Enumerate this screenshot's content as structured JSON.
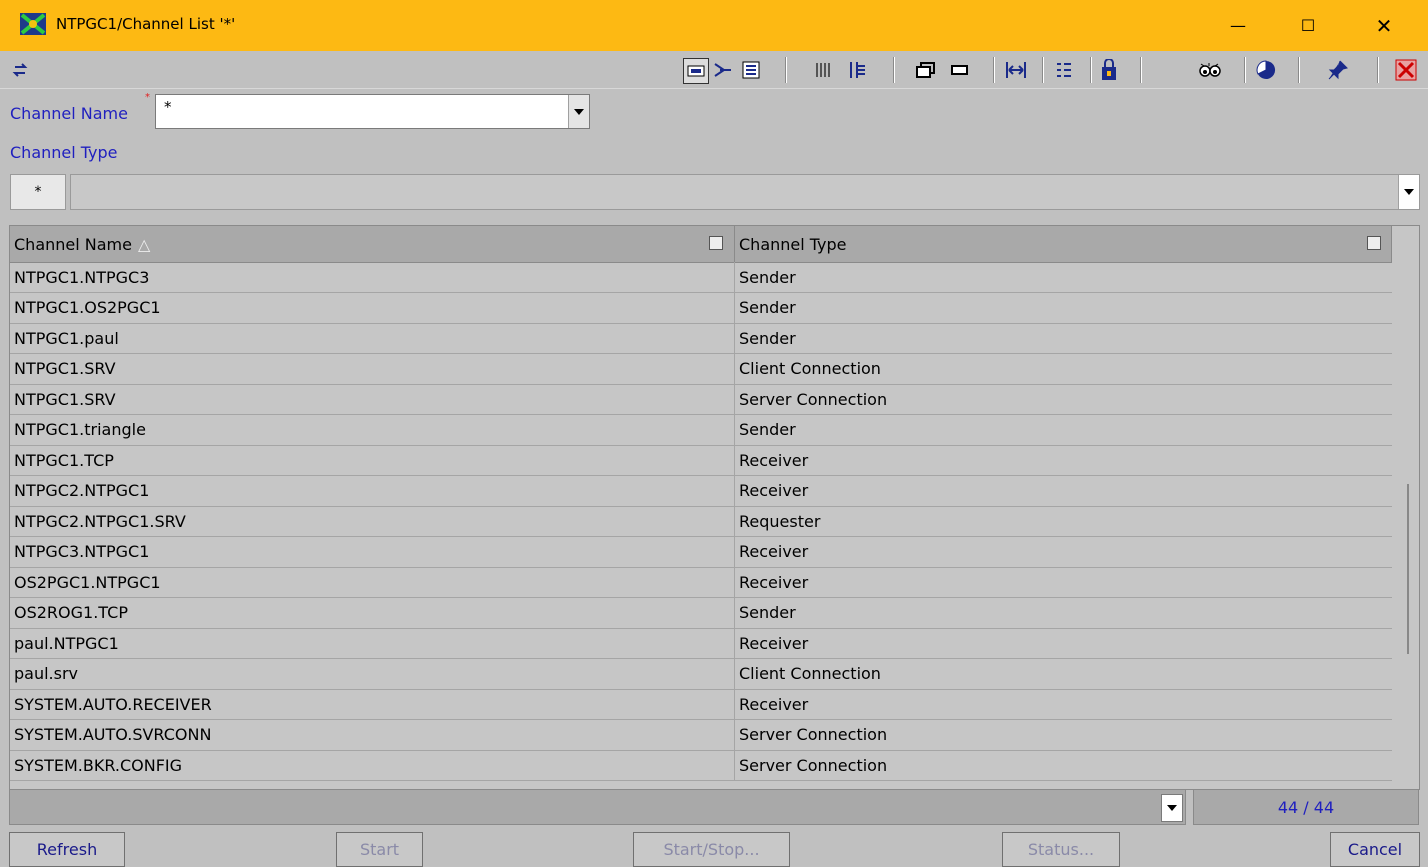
{
  "window": {
    "title": "NTPGC1/Channel List '*'",
    "minimize": "—",
    "maximize": "☐",
    "close": "✕"
  },
  "toolbar": {
    "icons": [
      "refresh-icon",
      "view-icon",
      "arrow-icon",
      "list-icon",
      "columns-icon",
      "split-icon",
      "window-icon",
      "rect-icon",
      "fit-width-icon",
      "tree-icon",
      "lock-icon",
      "eye-icon",
      "pie-icon",
      "pin-icon",
      "exit-icon"
    ]
  },
  "filter": {
    "channel_name_label": "Channel Name",
    "channel_name_required": "*",
    "channel_name_value": "*",
    "channel_type_label": "Channel Type",
    "channel_type_button": "*"
  },
  "table": {
    "columns": [
      "Channel Name",
      "Channel Type"
    ],
    "sort_indicator": "△",
    "rows": [
      [
        "NTPGC1.NTPGC3",
        "Sender"
      ],
      [
        "NTPGC1.OS2PGC1",
        "Sender"
      ],
      [
        "NTPGC1.paul",
        "Sender"
      ],
      [
        "NTPGC1.SRV",
        "Client Connection"
      ],
      [
        "NTPGC1.SRV",
        "Server Connection"
      ],
      [
        "NTPGC1.triangle",
        "Sender"
      ],
      [
        "NTPGC1.TCP",
        "Receiver"
      ],
      [
        "NTPGC2.NTPGC1",
        "Receiver"
      ],
      [
        "NTPGC2.NTPGC1.SRV",
        "Requester"
      ],
      [
        "NTPGC3.NTPGC1",
        "Receiver"
      ],
      [
        "OS2PGC1.NTPGC1",
        "Receiver"
      ],
      [
        "OS2ROG1.TCP",
        "Sender"
      ],
      [
        "paul.NTPGC1",
        "Receiver"
      ],
      [
        "paul.srv",
        "Client Connection"
      ],
      [
        "SYSTEM.AUTO.RECEIVER",
        "Receiver"
      ],
      [
        "SYSTEM.AUTO.SVRCONN",
        "Server Connection"
      ],
      [
        "SYSTEM.BKR.CONFIG",
        "Server Connection"
      ]
    ]
  },
  "status": {
    "count": "44 / 44"
  },
  "buttons": {
    "refresh": "Refresh",
    "start": "Start",
    "start_stop": "Start/Stop...",
    "status": "Status...",
    "cancel": "Cancel"
  },
  "colors": {
    "titlebar": "#fdb913",
    "label_blue": "#1f1fbf",
    "background": "#c0c0c0"
  }
}
